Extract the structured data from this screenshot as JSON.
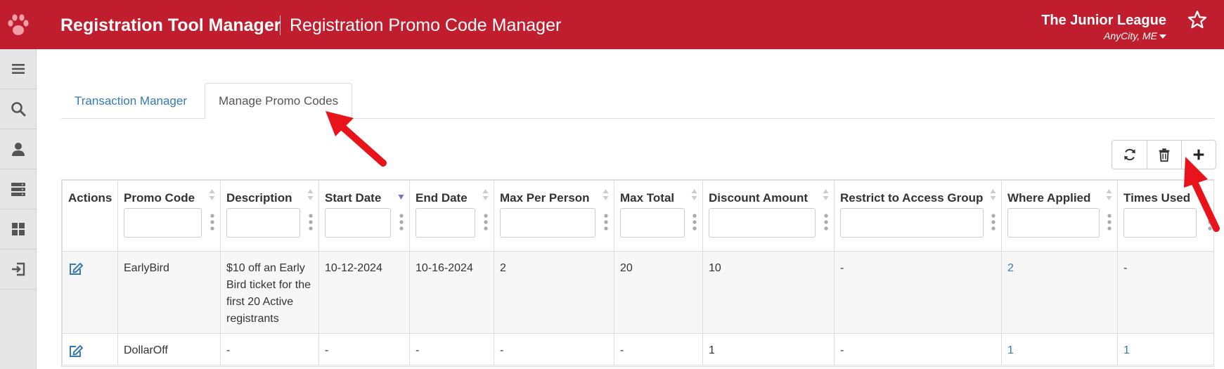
{
  "header": {
    "logo_icon": "paw-icon",
    "app_title": "Registration Tool Manager",
    "page_title": "Registration Promo Code Manager",
    "org_name": "The Junior League",
    "org_location": "AnyCity, ME",
    "favorite_icon": "star-icon",
    "brand_color": "#c01e2e"
  },
  "sidebar": {
    "items": [
      {
        "icon": "menu-icon"
      },
      {
        "icon": "search-icon"
      },
      {
        "icon": "user-icon"
      },
      {
        "icon": "server-icon"
      },
      {
        "icon": "dashboard-icon"
      },
      {
        "icon": "logout-icon"
      }
    ]
  },
  "tabs": [
    {
      "label": "Transaction Manager",
      "active": false
    },
    {
      "label": "Manage Promo Codes",
      "active": true
    }
  ],
  "toolbar": {
    "refresh_icon": "refresh-icon",
    "delete_icon": "trash-icon",
    "add_icon": "plus-icon"
  },
  "table": {
    "columns": [
      "Actions",
      "Promo Code",
      "Description",
      "Start Date",
      "End Date",
      "Max Per Person",
      "Max Total",
      "Discount Amount",
      "Restrict to Access Group",
      "Where Applied",
      "Times Used"
    ],
    "sorted_column": "Start Date",
    "rows": [
      {
        "promo_code": "EarlyBird",
        "description": "$10 off an Early Bird ticket for the first 20 Active registrants",
        "start_date": "10-12-2024",
        "end_date": "10-16-2024",
        "max_per_person": "2",
        "max_total": "20",
        "discount_amount": "10",
        "access_group": "-",
        "where_applied": "2",
        "times_used": "-"
      },
      {
        "promo_code": "DollarOff",
        "description": "-",
        "start_date": "-",
        "end_date": "-",
        "max_per_person": "-",
        "max_total": "-",
        "discount_amount": "1",
        "access_group": "-",
        "where_applied": "1",
        "times_used": "1"
      }
    ]
  },
  "annotation_color": "#e8131b"
}
